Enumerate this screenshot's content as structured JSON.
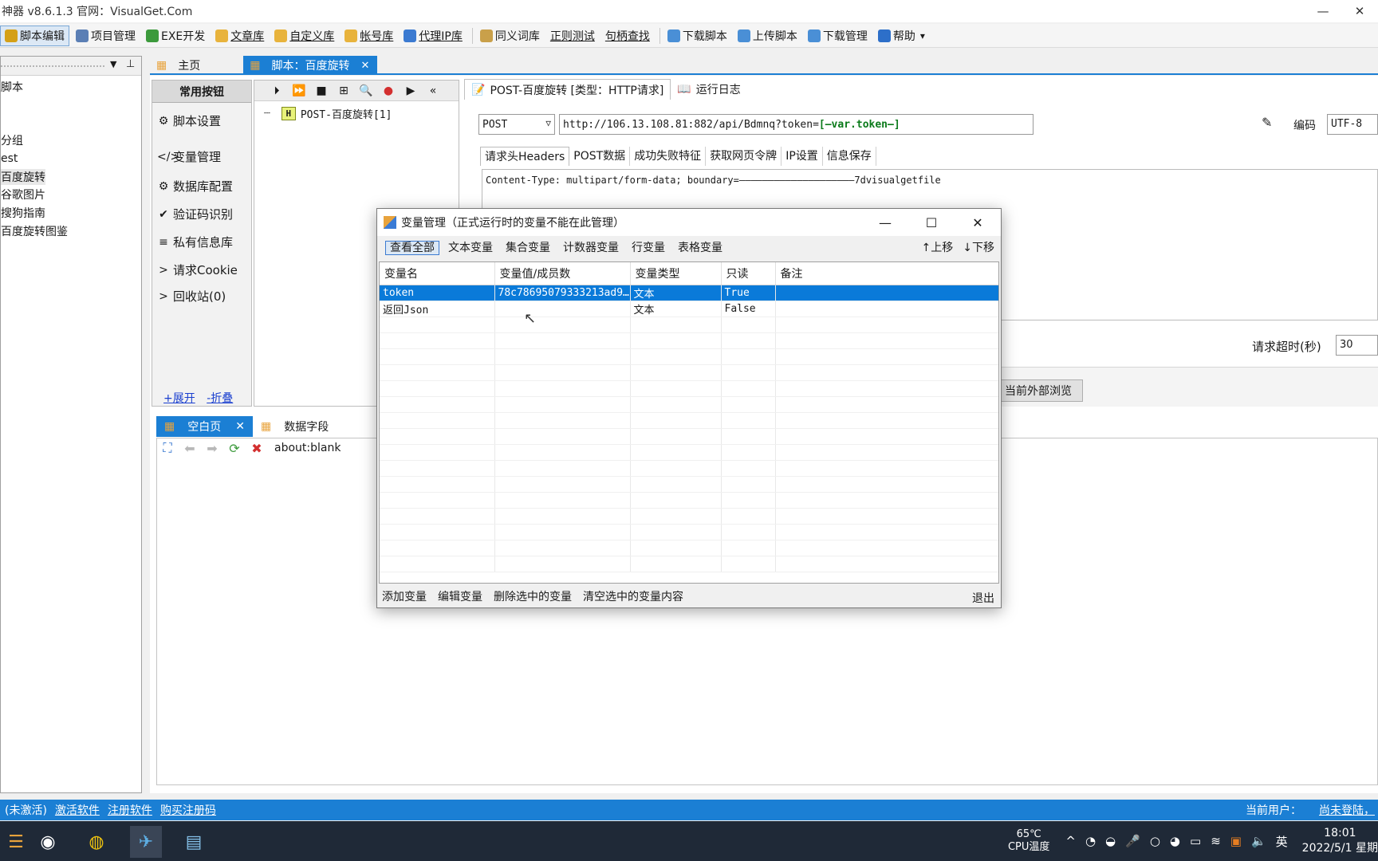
{
  "window": {
    "title": "神器 v8.6.1.3   官网：VisualGet.Com",
    "minimize": "—",
    "close": "✕"
  },
  "toolbar": {
    "items": [
      {
        "label": "脚本编辑",
        "icon": "script-edit-icon",
        "active": true,
        "color": "#d4a017"
      },
      {
        "label": "项目管理",
        "icon": "project-icon",
        "color": "#5b7fb5"
      },
      {
        "label": "EXE开发",
        "icon": "exe-icon",
        "color": "#3c9a3c"
      },
      {
        "label": "文章库",
        "icon": "folder-icon",
        "link": true,
        "color": "#e8b33c"
      },
      {
        "label": "自定义库",
        "icon": "folder-icon",
        "link": true,
        "color": "#e8b33c"
      },
      {
        "label": "帐号库",
        "icon": "folder-icon",
        "link": true,
        "color": "#e8b33c"
      },
      {
        "label": "代理IP库",
        "icon": "globe-icon",
        "link": true,
        "color": "#3b7ad1"
      },
      {
        "label": "同义词库",
        "icon": "book-icon",
        "color": "#c9a04a"
      },
      {
        "label": "正则测试",
        "link": true
      },
      {
        "label": "句柄查找",
        "link": true
      },
      {
        "label": "下载脚本",
        "icon": "cloud-down-icon",
        "color": "#4a8fd6"
      },
      {
        "label": "上传脚本",
        "icon": "cloud-up-icon",
        "color": "#4a8fd6"
      },
      {
        "label": "下载管理",
        "icon": "download-icon",
        "color": "#4a8fd6"
      },
      {
        "label": "帮助",
        "icon": "help-icon",
        "color": "#2d6fc9",
        "dropdown": "▾"
      }
    ]
  },
  "left_tree": {
    "items": [
      "脚本",
      "分组",
      "est",
      "百度旋转",
      "谷歌图片",
      "搜狗指南",
      "百度旋转图鉴"
    ]
  },
  "main_tabs": [
    {
      "label": "主页"
    },
    {
      "label": "脚本：百度旋转",
      "active": true,
      "close": "✕"
    }
  ],
  "common_buttons": {
    "title": "常用按钮",
    "items": [
      {
        "icon": "⚙",
        "label": "脚本设置"
      },
      {
        "icon": "</>",
        "label": "变量管理"
      },
      {
        "icon": "⚙",
        "label": "数据库配置"
      },
      {
        "icon": "✔",
        "label": "验证码识别"
      },
      {
        "icon": "≡",
        "label": "私有信息库"
      },
      {
        "icon": ">",
        "label": "请求Cookie"
      },
      {
        "icon": ">",
        "label": "回收站(0)"
      }
    ],
    "expand": "+展开",
    "collapse": "-折叠"
  },
  "script_tree": {
    "tools": [
      "⏵",
      "⏩",
      "■",
      "⊞",
      "🔍",
      "●",
      "▶",
      "«"
    ],
    "node_badge": "H",
    "node_label": "POST-百度旋转[1]"
  },
  "editor": {
    "tab_request": "POST-百度旋转 [类型：HTTP请求]",
    "tab_log": "运行日志",
    "method": "POST",
    "url_prefix": "http://106.13.108.81:882/api/Bdmnq?token=",
    "url_token": "[—var.token—]",
    "encoding_label": "编码",
    "encoding_value": "UTF-8",
    "subtabs": [
      "请求头Headers",
      "POST数据",
      "成功失败特征",
      "获取网页令牌",
      "IP设置",
      "信息保存"
    ],
    "headers_text": "Content-Type: multipart/form-data; boundary=————————————————————7dvisualgetfile",
    "timeout_label": "请求超时(秒)",
    "timeout_value": "30",
    "external_btn": "当前外部浏览"
  },
  "browser": {
    "tabs": [
      {
        "label": "空白页",
        "active": true,
        "close": "✕"
      },
      {
        "label": "数据字段"
      }
    ],
    "address": "about:blank"
  },
  "statusbar": {
    "state": "(未激活)",
    "links": [
      "激活软件",
      "注册软件",
      "购买注册码"
    ],
    "user_label": "当前用户：",
    "user_value": "尚未登陆，"
  },
  "taskbar": {
    "temp": "65℃",
    "temp_label": "CPU温度",
    "lang": "英",
    "time": "18:01",
    "date": "2022/5/1 星期"
  },
  "dialog": {
    "title": "变量管理（正式运行时的变量不能在此管理）",
    "filters": [
      "查看全部",
      "文本变量",
      "集合变量",
      "计数器变量",
      "行变量",
      "表格变量"
    ],
    "move_up": "↑上移",
    "move_down": "↓下移",
    "columns": [
      "变量名",
      "变量值/成员数",
      "变量类型",
      "只读",
      "备注"
    ],
    "rows": [
      {
        "name": "token",
        "value": "78c78695079333213ad9...",
        "type": "文本",
        "readonly": "True",
        "note": "",
        "selected": true
      },
      {
        "name": "返回Json",
        "value": "",
        "type": "文本",
        "readonly": "False",
        "note": ""
      }
    ],
    "footer": [
      "添加变量",
      "编辑变量",
      "删除选中的变量",
      "清空选中的变量内容"
    ],
    "exit": "退出"
  }
}
